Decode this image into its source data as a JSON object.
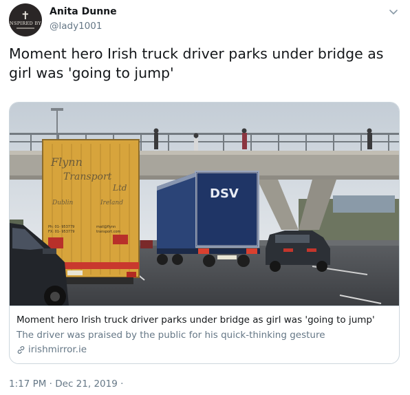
{
  "tweet": {
    "author": {
      "name": "Anita Dunne",
      "handle": "@lady1001",
      "avatar_text": "NSPIRED BY"
    },
    "text": "Moment hero Irish truck driver parks under bridge as girl was 'going to jump'",
    "timestamp": "1:17 PM · Dec 21, 2019 ·"
  },
  "card": {
    "title": "Moment hero Irish truck driver parks under bridge as girl was 'going to jump'",
    "description": "The driver was praised by the public for his quick-thinking gesture",
    "domain": "irishmirror.ie",
    "image": {
      "trailer1_lines": [
        "Flynn",
        "Transport",
        "Ltd",
        "Dublin",
        "Ireland"
      ],
      "trailer1_phone": [
        "Ph: 01- 953779",
        "FX: 01- 953779"
      ],
      "trailer1_email": [
        "mail@flynn",
        "transport.com"
      ],
      "trailer2_logo": "DSV"
    }
  },
  "colors": {
    "text_primary": "#14171a",
    "text_secondary": "#657786",
    "border": "#ccd6dd"
  },
  "icons": {
    "caret": "chevron-down-icon",
    "link": "link-icon"
  }
}
